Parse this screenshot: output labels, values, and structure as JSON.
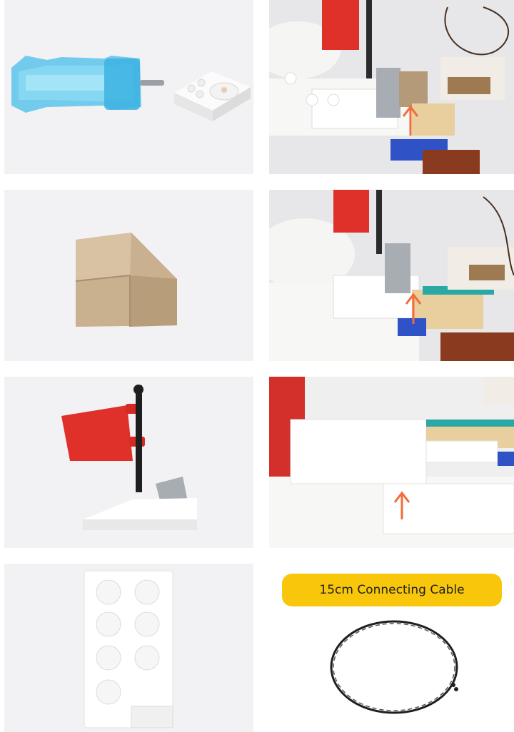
{
  "cable_label": "15cm Connecting Cable",
  "colors": {
    "accent_yellow": "#f8c70b",
    "arrow_orange": "#f26b3a",
    "flag_red": "#e0302a",
    "brick_tan": "#c9b08f",
    "brick_white": "#f7f7f5",
    "transparent_blue": "#5cc4ea"
  }
}
